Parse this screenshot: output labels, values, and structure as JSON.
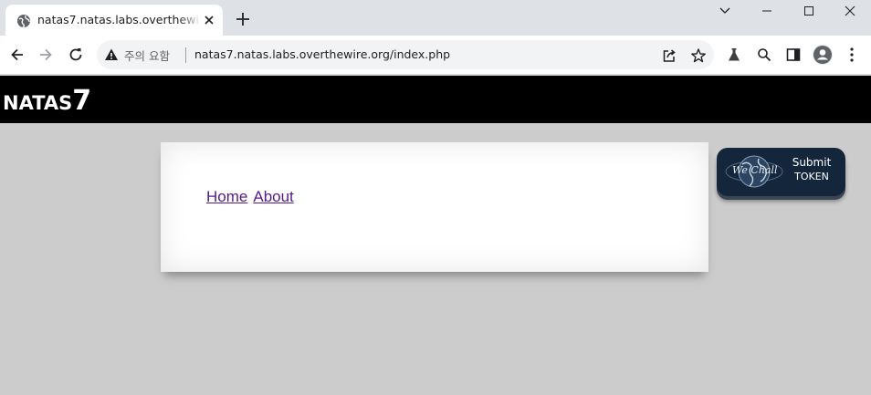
{
  "browser": {
    "tab": {
      "title": "natas7.natas.labs.overthewire.org",
      "favicon": "globe-icon"
    },
    "address_bar": {
      "security_label": "주의 요함",
      "url": "natas7.natas.labs.overthewire.org/index.php"
    },
    "icons": [
      "back-icon",
      "forward-icon",
      "reload-icon",
      "share-icon",
      "star-icon",
      "labs-icon",
      "search-icon",
      "side-panel-icon",
      "profile-icon",
      "menu-icon",
      "chevron-down-icon",
      "minimize-icon",
      "maximize-icon",
      "close-icon"
    ]
  },
  "page": {
    "header": {
      "title_prefix": "NATAS",
      "title_number": "7"
    },
    "links": {
      "home": "Home",
      "about": "About"
    },
    "wechall": {
      "logo_text": "We Chall",
      "line1": "Submit",
      "line2": "TOKEN"
    },
    "colors": {
      "header": "#000000",
      "background": "#cccccc",
      "link_visited": "#551a8b",
      "wechall_bg": "#14263c"
    }
  }
}
